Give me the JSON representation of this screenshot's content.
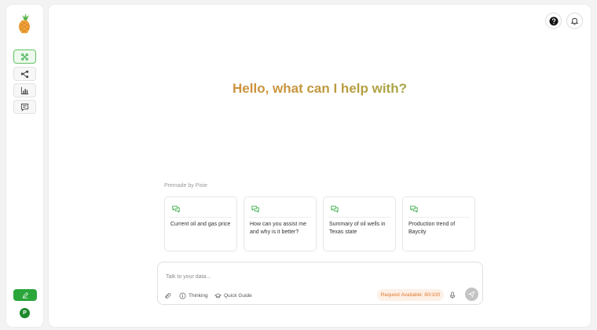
{
  "sidebar": {
    "logo_icon": "pineapple-logo-icon",
    "nav_items": [
      {
        "id": "chat",
        "icon": "network-icon",
        "active": true
      },
      {
        "id": "workflow",
        "icon": "nodes-icon",
        "active": false
      },
      {
        "id": "analytics",
        "icon": "bar-chart-icon",
        "active": false
      },
      {
        "id": "messages",
        "icon": "message-icon",
        "active": false
      }
    ],
    "new_chat_icon": "pencil-icon",
    "avatar_initial": "P"
  },
  "header": {
    "help_icon": "help-icon",
    "notification_icon": "bell-icon"
  },
  "main": {
    "greeting": "Hello, what can I help with?",
    "premade_label": "Premade by Pixie",
    "cards": [
      {
        "text": "Current oil and gas price"
      },
      {
        "text": "How can you assist me and why is it better?"
      },
      {
        "text": "Summary of oil wells in Texas state"
      },
      {
        "text": "Production trend of Baycity"
      }
    ]
  },
  "composer": {
    "placeholder": "Talk to your data...",
    "attach_icon": "paperclip-icon",
    "thinking_label": "Thinking",
    "quick_guide_label": "Quick Guide",
    "request_label": "Request Available: 80/100",
    "mic_icon": "microphone-icon",
    "send_icon": "send-icon"
  },
  "colors": {
    "accent_green": "#2aa63a",
    "greeting_orange": "#d9843a",
    "greeting_green": "#6fbf4e",
    "request_orange": "#e0782e"
  }
}
